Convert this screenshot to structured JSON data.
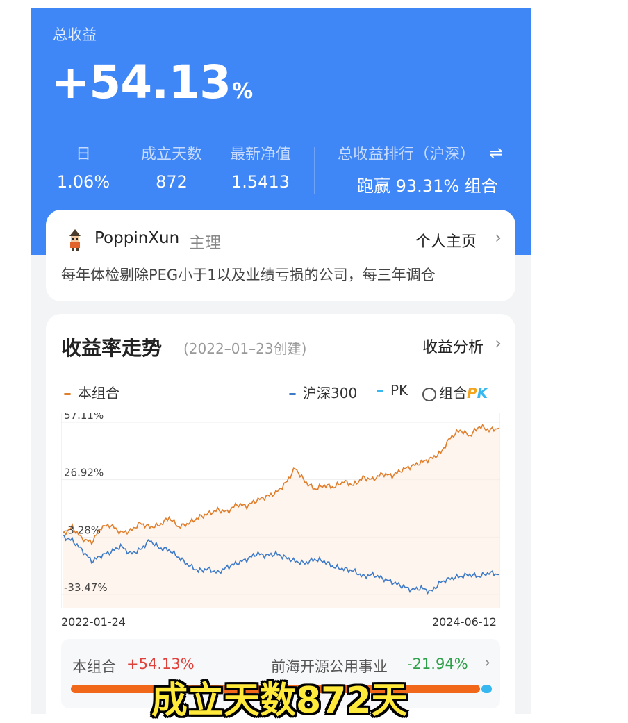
{
  "header": {
    "total_label": "总收益",
    "total_value": "+54.13",
    "total_unit": "%",
    "stats": [
      {
        "label": "日",
        "value": "1.06%"
      },
      {
        "label": "成立天数",
        "value": "872"
      },
      {
        "label": "最新净值",
        "value": "1.5413"
      }
    ],
    "rank_label": "总收益排行（沪深）",
    "rank_prefix": "跑赢",
    "rank_value": "93.31%",
    "rank_suffix": "组合",
    "swap_icon": "⇌"
  },
  "manager": {
    "name": "PoppinXun",
    "role": "主理",
    "homepage_label": "个人主页",
    "description": "每年体检剔除PEG小于1以及业绩亏损的公司，每三年调仓"
  },
  "chart_section": {
    "title": "收益率走势",
    "created": "(2022–01–23创建)",
    "analysis_label": "收益分析",
    "legend": {
      "portfolio": "本组合",
      "index": "沪深300",
      "pk": "PK",
      "pk_toggle_label": "组合",
      "pk_badge_p": "P",
      "pk_badge_k": "K"
    }
  },
  "chart_data": {
    "type": "line",
    "x_start": "2022-01-24",
    "x_end": "2024-06-12",
    "y_ticks": [
      "57.11%",
      "26.92%",
      "-3.28%",
      "-33.47%"
    ],
    "ylim": [
      -33.47,
      57.11
    ],
    "colors": {
      "portfolio": "#e07e2c",
      "index": "#3d7ac7",
      "pk": "#37b7ef"
    },
    "series": [
      {
        "name": "本组合",
        "values": [
          -2,
          2,
          -4,
          -6,
          2,
          3,
          -1,
          0,
          4,
          2,
          3,
          7,
          2,
          4,
          7,
          9,
          11,
          10,
          14,
          13,
          16,
          18,
          20,
          25,
          33,
          26,
          22,
          24,
          23,
          26,
          24,
          28,
          27,
          30,
          29,
          32,
          34,
          36,
          38,
          41,
          49,
          53,
          50,
          55,
          53,
          54
        ]
      },
      {
        "name": "沪深300",
        "values": [
          -3,
          -5,
          -10,
          -16,
          -13,
          -11,
          -8,
          -12,
          -10,
          -5,
          -9,
          -10,
          -14,
          -18,
          -21,
          -20,
          -22,
          -19,
          -17,
          -15,
          -12,
          -13,
          -12,
          -14,
          -16,
          -17,
          -15,
          -16,
          -19,
          -20,
          -21,
          -24,
          -23,
          -25,
          -27,
          -29,
          -31,
          -30,
          -32,
          -27,
          -25,
          -24,
          -23,
          -24,
          -22,
          -23
        ]
      }
    ]
  },
  "pk": {
    "left_label": "本组合",
    "left_value": "+54.13%",
    "right_label": "前海开源公用事业",
    "right_value": "-21.94%",
    "left_share": 0.975
  },
  "caption": "成立天数872天"
}
